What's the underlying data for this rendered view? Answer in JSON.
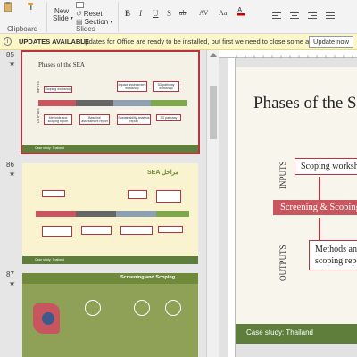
{
  "ribbon": {
    "new_slide": "New",
    "new_slide_sub": "Slide",
    "reset": "Reset",
    "section": "Section",
    "groups": {
      "clipboard": "Clipboard",
      "slides": "Slides",
      "font": "Font",
      "paragraph": "Paragraph"
    },
    "font_buttons": [
      "B",
      "I",
      "U",
      "S",
      "ab",
      "AV",
      "Aa",
      "A"
    ]
  },
  "update_bar": {
    "title": "UPDATES AVAILABLE",
    "message": "Updates for Office are ready to be installed, but first we need to close some apps.",
    "button": "Update now"
  },
  "thumbnails": [
    {
      "number": "85",
      "star": "★"
    },
    {
      "number": "86",
      "star": "★"
    },
    {
      "number": "87",
      "star": "★"
    }
  ],
  "slide85": {
    "title": "Phases of the SEA",
    "inputs": "INPUTS",
    "outputs": "OUTPUTS",
    "box_scoping": "Scoping workshop",
    "box_impact": "Impact assessment workshop",
    "box_3d_top": "3D pathway workshop",
    "phase1": "Screening & Scoping",
    "phase2": "Baseline Assessment",
    "phase3": "Sustainability Analysis",
    "phase4": "3D pathway",
    "out1": "Methods and scoping report",
    "out2": "Baseline assessment report",
    "out3": "Sustainability analysis report",
    "out4": "3D pathway",
    "footer": "Case study: Thailand"
  },
  "slide86": {
    "title": "SEA مراحل",
    "footer": "Case study: Thailand"
  },
  "slide87": {
    "title": "Screening and Scoping"
  },
  "main_slide": {
    "title": "Phases of the SEA",
    "inputs": "INPUTS",
    "outputs": "OUTPUTS",
    "box_input": "Scoping workshop",
    "bar": "Screening & Scoping",
    "box_output_l1": "Methods and",
    "box_output_l2": "scoping report",
    "footer": "Case study: Thailand"
  },
  "colors": {
    "accent": "#b5343f",
    "bar": "#c9555e",
    "footer": "#5f7d3b",
    "update_bg": "#fdf6c8"
  }
}
